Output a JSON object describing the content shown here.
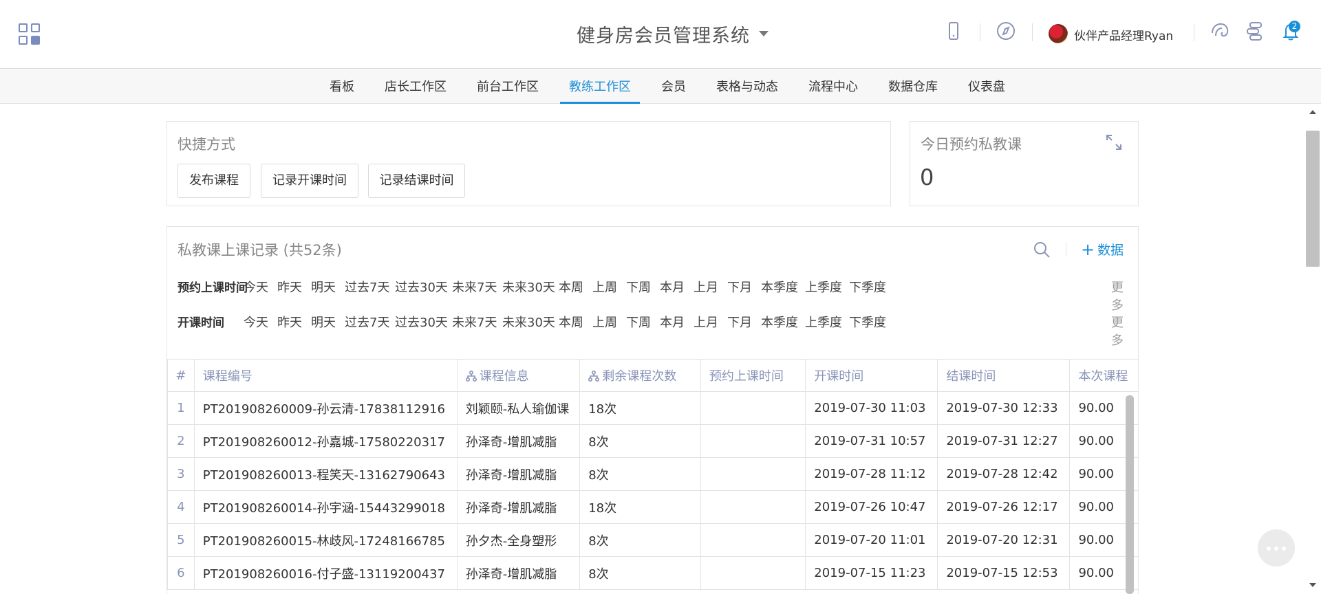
{
  "header": {
    "title": "健身房会员管理系统",
    "user_name": "伙伴产品经理Ryan",
    "notification_count": "2",
    "icons": [
      "apps-grid-icon",
      "mobile-icon",
      "compass-icon",
      "avatar",
      "brain-icon",
      "workflow-icon",
      "bell-icon"
    ]
  },
  "nav": {
    "items": [
      {
        "label": "看板"
      },
      {
        "label": "店长工作区"
      },
      {
        "label": "前台工作区"
      },
      {
        "label": "教练工作区",
        "active": true
      },
      {
        "label": "会员"
      },
      {
        "label": "表格与动态"
      },
      {
        "label": "流程中心"
      },
      {
        "label": "数据仓库"
      },
      {
        "label": "仪表盘"
      }
    ]
  },
  "quick": {
    "title": "快捷方式",
    "buttons": [
      "发布课程",
      "记录开课时间",
      "记录结课时间"
    ]
  },
  "today": {
    "title": "今日预约私教课",
    "count": "0"
  },
  "records": {
    "title": "私教课上课记录 (共52条)",
    "add_label": "数据",
    "filters": [
      {
        "label": "预约上课时间",
        "options": [
          "今天",
          "昨天",
          "明天",
          "过去7天",
          "过去30天",
          "未来7天",
          "未来30天",
          "本周",
          "上周",
          "下周",
          "本月",
          "上月",
          "下月",
          "本季度",
          "上季度",
          "下季度"
        ],
        "more": "更多"
      },
      {
        "label": "开课时间",
        "options": [
          "今天",
          "昨天",
          "明天",
          "过去7天",
          "过去30天",
          "未来7天",
          "未来30天",
          "本周",
          "上周",
          "下周",
          "本月",
          "上月",
          "下月",
          "本季度",
          "上季度",
          "下季度"
        ],
        "more": "更多"
      }
    ],
    "columns": [
      "#",
      "课程编号",
      "课程信息",
      "剩余课程次数",
      "预约上课时间",
      "开课时间",
      "结课时间",
      "本次课程"
    ],
    "rows": [
      [
        "1",
        "PT201908260009-孙云清-17838112916",
        "刘颖颐-私人瑜伽课",
        "18次",
        "",
        "2019-07-30 11:03",
        "2019-07-30 12:33",
        "90.00"
      ],
      [
        "2",
        "PT201908260012-孙嘉城-17580220317",
        "孙泽奇-增肌减脂",
        "8次",
        "",
        "2019-07-31 10:57",
        "2019-07-31 12:27",
        "90.00"
      ],
      [
        "3",
        "PT201908260013-程笑天-13162790643",
        "孙泽奇-增肌减脂",
        "8次",
        "",
        "2019-07-28 11:12",
        "2019-07-28 12:42",
        "90.00"
      ],
      [
        "4",
        "PT201908260014-孙宇涵-15443299018",
        "孙泽奇-增肌减脂",
        "18次",
        "",
        "2019-07-26 10:47",
        "2019-07-26 12:17",
        "90.00"
      ],
      [
        "5",
        "PT201908260015-林歧风-17248166785",
        "孙夕杰-全身塑形",
        "8次",
        "",
        "2019-07-20 11:01",
        "2019-07-20 12:31",
        "90.00"
      ],
      [
        "6",
        "PT201908260016-付子盛-13119200437",
        "孙泽奇-增肌减脂",
        "8次",
        "",
        "2019-07-15 11:23",
        "2019-07-15 12:53",
        "90.00"
      ]
    ]
  },
  "colors": {
    "accent": "#1d8fd8",
    "icon": "#8a94b8",
    "border": "#e3e3e3"
  }
}
